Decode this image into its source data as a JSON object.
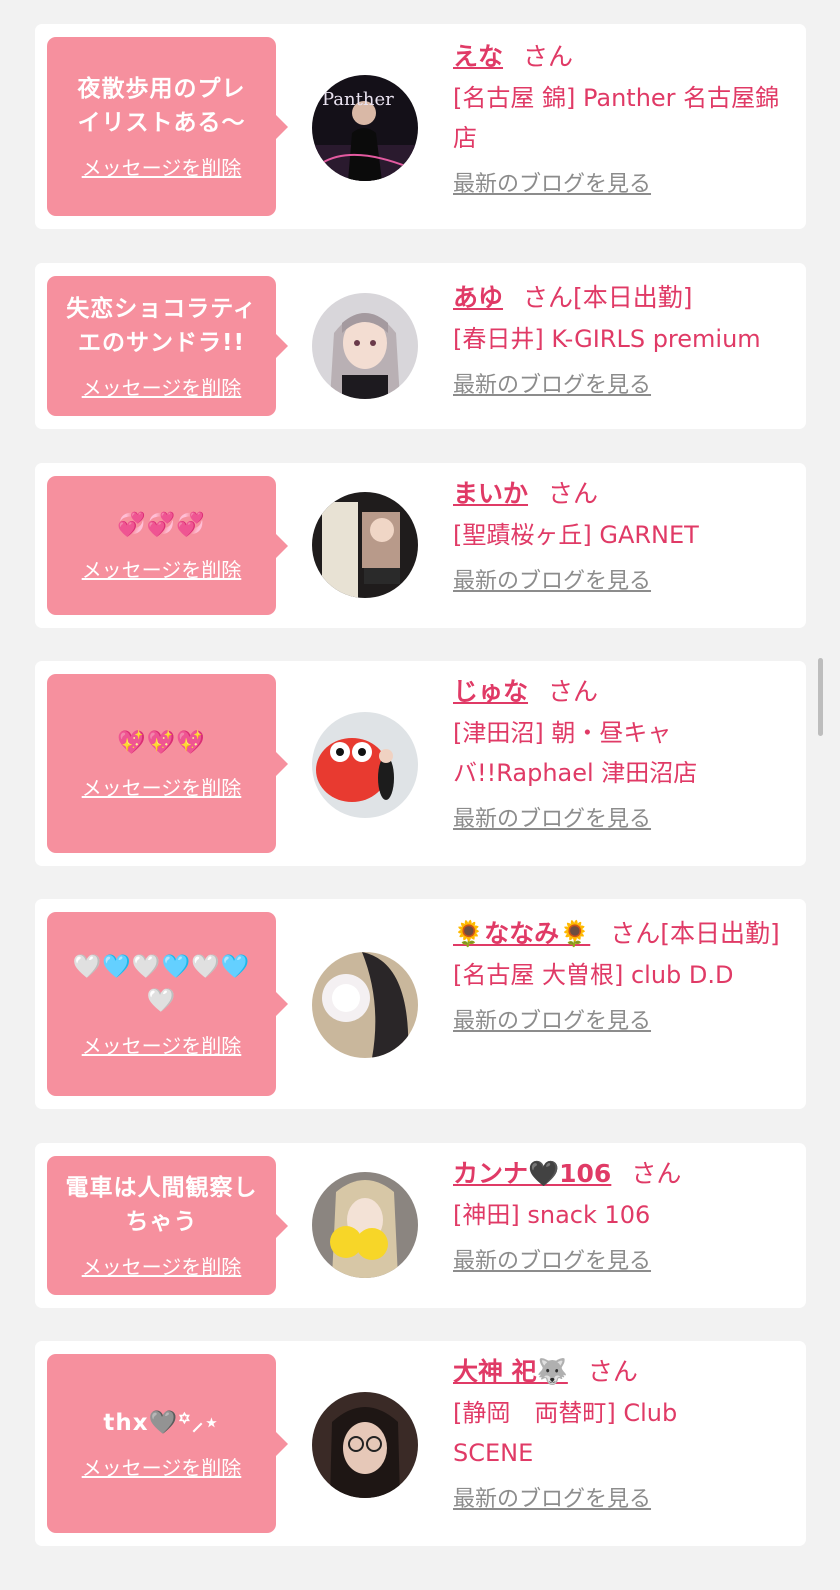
{
  "accent_color": "#e03a66",
  "bubble_color": "#f6909e",
  "cards": [
    {
      "message": "夜散歩用のプレイリストある〜",
      "delete_label": "メッセージを削除",
      "name": "えな",
      "honorific": "さん",
      "status": "",
      "shop": "[名古屋 錦] Panther 名古屋錦店",
      "blog_link": "最新のブログを見る",
      "avatar_text": "Panther"
    },
    {
      "message": "失恋ショコラティエのサンドラ!!",
      "delete_label": "メッセージを削除",
      "name": "あゆ",
      "honorific": "さん",
      "status": "[本日出勤]",
      "shop": "[春日井] K-GIRLS premium",
      "blog_link": "最新のブログを見る"
    },
    {
      "message": "💞💞💞",
      "delete_label": "メッセージを削除",
      "name": "まいか",
      "honorific": "さん",
      "status": "",
      "shop": "[聖蹟桜ヶ丘] GARNET",
      "blog_link": "最新のブログを見る"
    },
    {
      "message": "💖💖💖",
      "delete_label": "メッセージを削除",
      "name": "じゅな",
      "honorific": "さん",
      "status": "",
      "shop": "[津田沼] 朝・昼キャバ!!Raphael 津田沼店",
      "blog_link": "最新のブログを見る"
    },
    {
      "message": "🤍🩵🤍🩵🤍🩵🤍",
      "delete_label": "メッセージを削除",
      "name": "🌻ななみ🌻",
      "honorific": "さん",
      "status": "[本日出勤]",
      "shop": "[名古屋 大曽根] club D.D",
      "blog_link": "最新のブログを見る"
    },
    {
      "message": "電車は人間観察しちゃう",
      "delete_label": "メッセージを削除",
      "name": "カンナ🖤106",
      "honorific": "さん",
      "status": "",
      "shop": "[神田] snack 106",
      "blog_link": "最新のブログを見る"
    },
    {
      "message": "thx🩶꙳⸝⋆",
      "delete_label": "メッセージを削除",
      "name": "大神 祀🐺",
      "honorific": "さん",
      "status": "",
      "shop": "[静岡　両替町] Club SCENE",
      "blog_link": "最新のブログを見る"
    }
  ]
}
